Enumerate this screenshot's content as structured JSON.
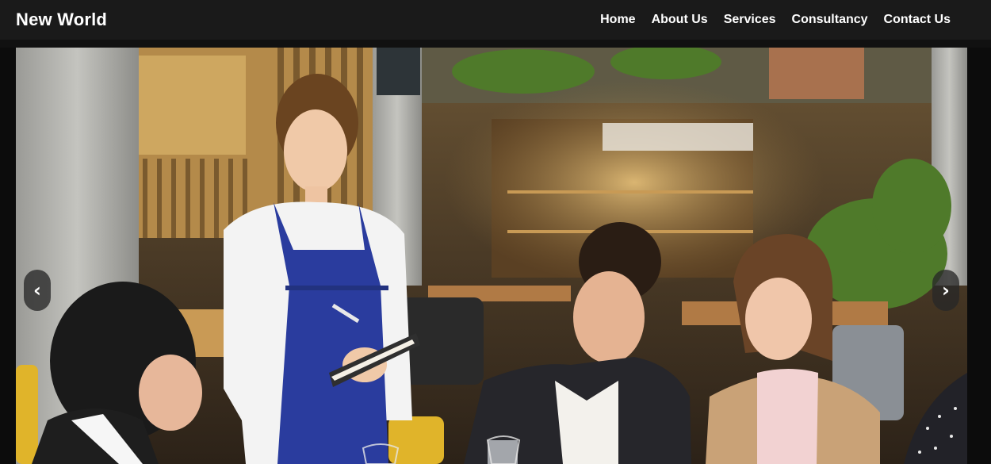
{
  "brand": {
    "name": "New World"
  },
  "nav": {
    "items": [
      {
        "label": "Home"
      },
      {
        "label": "About Us"
      },
      {
        "label": "Services"
      },
      {
        "label": "Consultancy"
      },
      {
        "label": "Contact Us"
      }
    ]
  },
  "carousel": {
    "prev_icon": "‹",
    "next_icon": "›",
    "slide_subject": "waitress-taking-order-restaurant-photo"
  },
  "colors": {
    "navbar_bg": "#1a1a1a",
    "text": "#ffffff",
    "apron": "#2a3c9e"
  }
}
